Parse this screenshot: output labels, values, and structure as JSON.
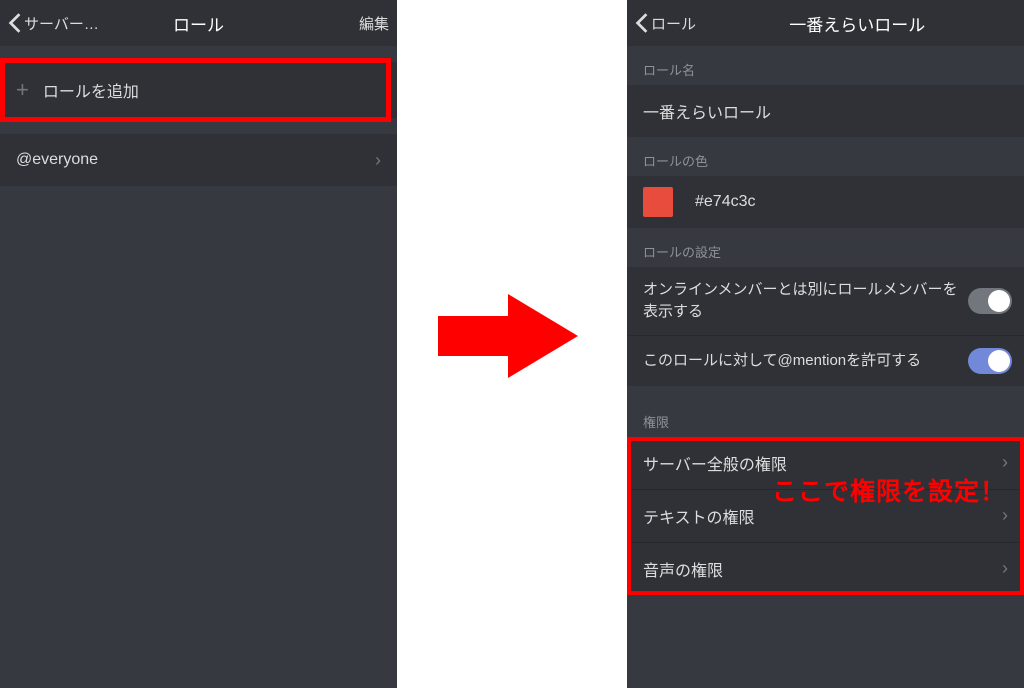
{
  "left": {
    "header": {
      "back": "サーバー…",
      "title": "ロール",
      "edit": "編集"
    },
    "add_role": "ロールを追加",
    "everyone": "@everyone"
  },
  "right": {
    "header": {
      "back": "ロール",
      "title": "一番えらいロール"
    },
    "sections": {
      "name_label": "ロール名",
      "name_value": "一番えらいロール",
      "color_label": "ロールの色",
      "color_value": "#e74c3c",
      "settings_label": "ロールの設定",
      "toggle_display": "オンラインメンバーとは別にロールメンバーを表示する",
      "toggle_mention": "このロールに対して@mentionを許可する",
      "perm_label": "権限",
      "perm_server": "サーバー全般の権限",
      "perm_text": "テキストの権限",
      "perm_voice": "音声の権限"
    }
  },
  "annotation": "ここで権限を設定！"
}
